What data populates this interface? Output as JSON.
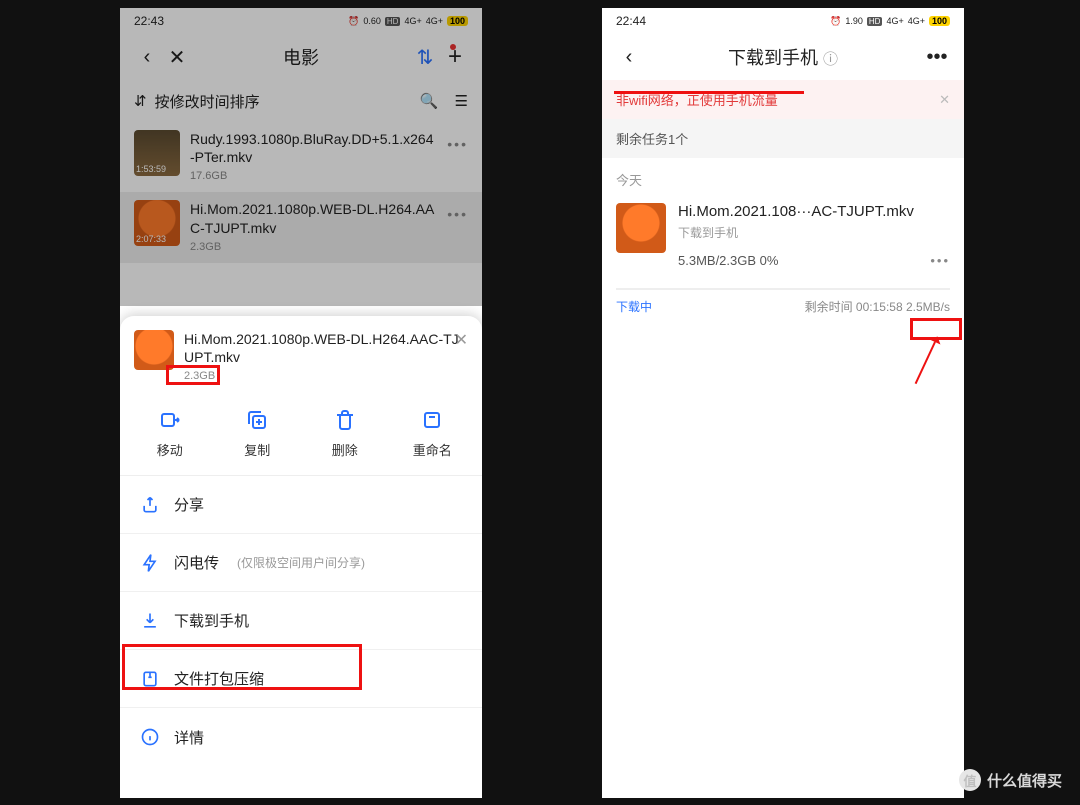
{
  "left": {
    "status": {
      "time": "22:43",
      "net_rate": "0.60",
      "hd": "HD",
      "sig1": "4G+",
      "sig2": "4G+",
      "battery": "100"
    },
    "nav": {
      "title": "电影"
    },
    "sort": {
      "label": "按修改时间排序"
    },
    "files": [
      {
        "name": "Rudy.1993.1080p.BluRay.DD+5.1.x264-PTer.mkv",
        "size": "17.6GB",
        "duration": "1:53:59"
      },
      {
        "name": "Hi.Mom.2021.1080p.WEB-DL.H264.AAC-TJUPT.mkv",
        "size": "2.3GB",
        "duration": "2:07:33"
      }
    ],
    "sheet": {
      "file": {
        "name": "Hi.Mom.2021.1080p.WEB-DL.H264.AAC-TJUPT.mkv",
        "size": "2.3GB"
      },
      "actions": {
        "move": "移动",
        "copy": "复制",
        "delete": "删除",
        "rename": "重命名"
      },
      "menu": {
        "share": "分享",
        "flash": "闪电传",
        "flash_sub": "(仅限极空间用户间分享)",
        "download": "下载到手机",
        "zip": "文件打包压缩",
        "detail": "详情"
      }
    }
  },
  "right": {
    "status": {
      "time": "22:44",
      "net_rate": "1.90",
      "hd": "HD",
      "sig1": "4G+",
      "sig2": "4G+",
      "battery": "100"
    },
    "nav": {
      "title": "下载到手机"
    },
    "banner": {
      "text": "非wifi网络，正使用手机流量"
    },
    "remaining": "剩余任务1个",
    "day": "今天",
    "task": {
      "name": "Hi.Mom.2021.108···AC-TJUPT.mkv",
      "sub": "下载到手机",
      "progress": "5.3MB/2.3GB   0%",
      "state": "下载中",
      "eta_label": "剩余时间",
      "eta_time": "00:15:58",
      "speed": "2.5MB/s"
    }
  },
  "watermark": "什么值得买"
}
